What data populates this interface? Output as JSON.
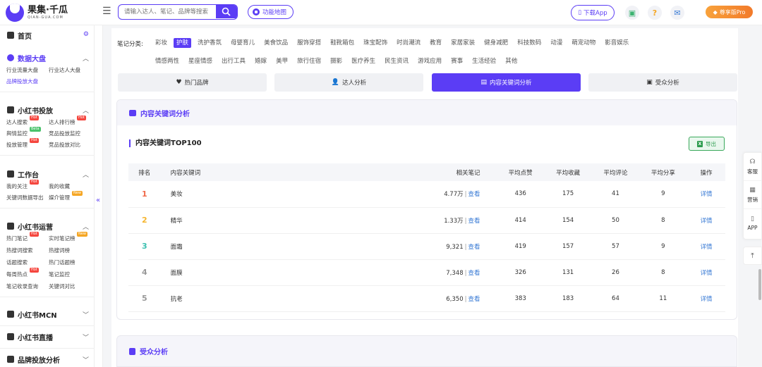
{
  "header": {
    "logo_title": "果集·千瓜",
    "logo_sub": "QIAN-GUA.COM",
    "search_placeholder": "请输入达人、笔记、品牌等搜索",
    "feature_map": "功能地图",
    "download": "下载App",
    "vip": "尊享版Pro",
    "icons": [
      "menu-icon",
      "search-icon",
      "briefcase-icon",
      "help-icon",
      "mail-icon",
      "diamond-icon"
    ]
  },
  "sidebar": {
    "home": "首页",
    "sections": [
      {
        "title": "数据大盘",
        "items": [
          "行业流量大盘",
          "行业达人大盘",
          "品牌投放大盘"
        ]
      },
      {
        "title": "小红书投放",
        "items": [
          "达人搜索",
          "达人排行榜",
          "舆情监控",
          "竞品投放监控",
          "投放管理",
          "竞品投放对比"
        ]
      },
      {
        "title": "工作台",
        "items": [
          "我的关注",
          "我的收藏",
          "关键词数据导出",
          "媒介管理"
        ]
      },
      {
        "title": "小红书运营",
        "items": [
          "热门笔记",
          "实时笔记榜",
          "热搜词搜索",
          "热搜词榜",
          "话题搜索",
          "热门话题榜",
          "每周热点",
          "笔记监控",
          "笔记收录查询",
          "关键词对比"
        ]
      },
      {
        "title": "小红书MCN"
      },
      {
        "title": "小红书直播"
      },
      {
        "title": "品牌投放分析"
      }
    ],
    "badges": {
      "hot": "Hot",
      "new": "New",
      "beta": "Beta"
    }
  },
  "main": {
    "category_label": "笔记分类:",
    "categories": [
      "彩妆",
      "护肤",
      "洗护香氛",
      "母婴育儿",
      "美食饮品",
      "服饰穿搭",
      "鞋靴箱包",
      "珠宝配饰",
      "时尚潮流",
      "教育",
      "家居家装",
      "健身减肥",
      "科技数码",
      "动漫",
      "萌宠动物",
      "影音娱乐",
      "情感两性",
      "星座情感",
      "出行工具",
      "婚嫁",
      "美甲",
      "旅行住宿",
      "摄影",
      "医疗养生",
      "民生资讯",
      "游戏应用",
      "赛事",
      "生活经验",
      "其他"
    ],
    "active_category": "护肤",
    "tabs": [
      "热门品牌",
      "达人分析",
      "内容关键词分析",
      "受众分析"
    ],
    "panel_title": "内容关键词分析",
    "sub_title": "内容关键词TOP100",
    "export": "导出",
    "table": {
      "headers": [
        "排名",
        "内容关键词",
        "相关笔记",
        "平均点赞",
        "平均收藏",
        "平均评论",
        "平均分享",
        "操作"
      ],
      "rows": [
        {
          "rank": "1",
          "keyword": "美妆",
          "notes": "4.77万",
          "likes": "436",
          "favs": "175",
          "comments": "41",
          "shares": "9"
        },
        {
          "rank": "2",
          "keyword": "精华",
          "notes": "1.33万",
          "likes": "414",
          "favs": "154",
          "comments": "50",
          "shares": "8"
        },
        {
          "rank": "3",
          "keyword": "面霜",
          "notes": "9,321",
          "likes": "419",
          "favs": "157",
          "comments": "57",
          "shares": "9"
        },
        {
          "rank": "4",
          "keyword": "面膜",
          "notes": "7,348",
          "likes": "326",
          "favs": "131",
          "comments": "26",
          "shares": "8"
        },
        {
          "rank": "5",
          "keyword": "抗老",
          "notes": "6,350",
          "likes": "383",
          "favs": "183",
          "comments": "64",
          "shares": "11"
        }
      ],
      "view_label": "查看",
      "sep": "|",
      "detail_label": "详情"
    },
    "audience_title": "受众分析"
  },
  "float": {
    "service": "客服",
    "marketing": "营销",
    "app": "APP"
  },
  "colors": {
    "accent": "#5b3df5",
    "rank1": "#f06a4a",
    "rank2": "#f5b52e",
    "rank3": "#3cc0b0",
    "rank_other": "#999999",
    "link": "#3a7bd5"
  }
}
